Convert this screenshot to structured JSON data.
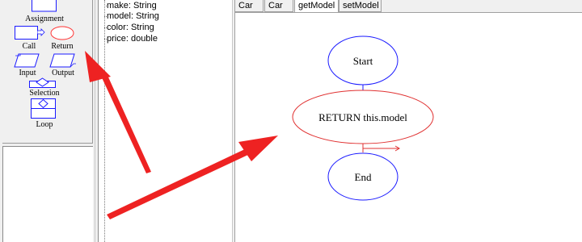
{
  "palette": {
    "items": [
      {
        "label": "Assignment",
        "icon": "assignment-icon"
      },
      {
        "label": "Call",
        "icon": "call-icon"
      },
      {
        "label": "Return",
        "icon": "return-icon"
      },
      {
        "label": "Input",
        "icon": "input-icon"
      },
      {
        "label": "Output",
        "icon": "output-icon"
      },
      {
        "label": "Selection",
        "icon": "selection-icon"
      },
      {
        "label": "Loop",
        "icon": "loop-icon"
      }
    ],
    "shape_color": "#1a1aff",
    "return_color": "#ff3333"
  },
  "tree": {
    "items": [
      "make: String",
      "model: String",
      "color: String",
      "price: double"
    ]
  },
  "tabs": [
    {
      "label": "Car",
      "active": false
    },
    {
      "label": "Car",
      "active": false
    },
    {
      "label": "getModel",
      "active": true
    },
    {
      "label": "setModel",
      "active": false
    }
  ],
  "flowchart": {
    "start_label": "Start",
    "return_label": "RETURN this.model",
    "end_label": "End",
    "start_color": "#1a1aff",
    "return_color": "#e03030"
  },
  "annotation": {
    "arrow_color": "#ee2222"
  }
}
